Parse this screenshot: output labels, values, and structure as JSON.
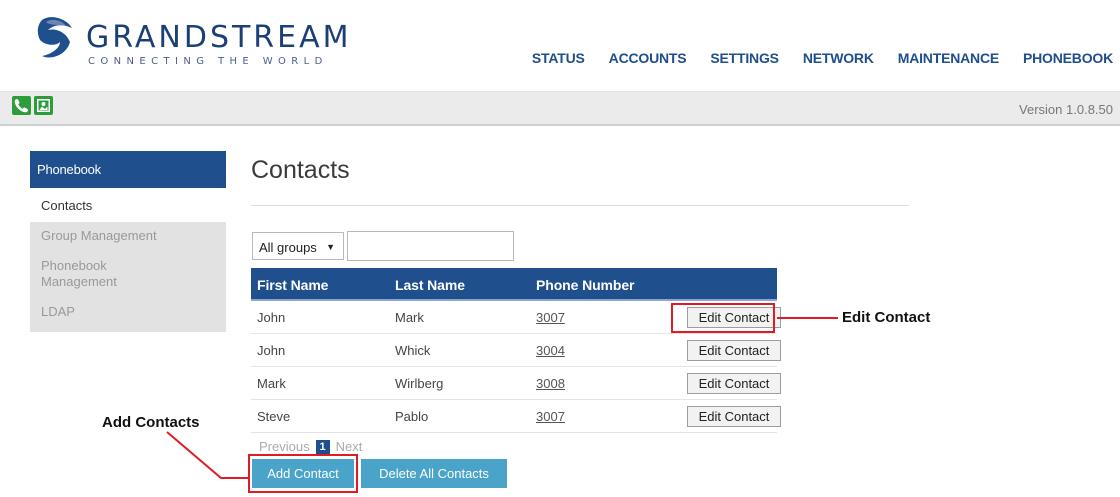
{
  "brand": {
    "name": "GRANDSTREAM",
    "tagline": "CONNECTING THE WORLD"
  },
  "topnav": [
    "STATUS",
    "ACCOUNTS",
    "SETTINGS",
    "NETWORK",
    "MAINTENANCE",
    "PHONEBOOK"
  ],
  "subbar": {
    "icons": [
      "phone-icon",
      "contact-card-icon"
    ],
    "version": "Version 1.0.8.50"
  },
  "sidebar": {
    "header": "Phonebook",
    "active": "Contacts",
    "items": [
      "Group Management",
      "Phonebook Management",
      "LDAP"
    ]
  },
  "main": {
    "title": "Contacts",
    "group_select": "All groups",
    "search_value": "",
    "columns": [
      "First Name",
      "Last Name",
      "Phone Number"
    ],
    "rows": [
      {
        "first": "John",
        "last": "Mark",
        "phone": "3007",
        "action": "Edit Contact"
      },
      {
        "first": "John",
        "last": "Whick",
        "phone": "3004",
        "action": "Edit Contact"
      },
      {
        "first": "Mark",
        "last": "Wirlberg",
        "phone": "3008",
        "action": "Edit Contact"
      },
      {
        "first": "Steve",
        "last": "Pablo",
        "phone": "3007",
        "action": "Edit Contact"
      }
    ],
    "pager": {
      "previous": "Previous",
      "page": "1",
      "next": "Next"
    },
    "add_button": "Add Contact",
    "delete_all_button": "Delete All Contacts"
  },
  "annotations": {
    "edit_contact": "Edit Contact",
    "add_contacts": "Add Contacts",
    "color": "#e01b24"
  },
  "colors": {
    "brand_blue": "#1f4f8d",
    "button_blue": "#4aa3c9",
    "icon_green": "#2e9c3b"
  }
}
